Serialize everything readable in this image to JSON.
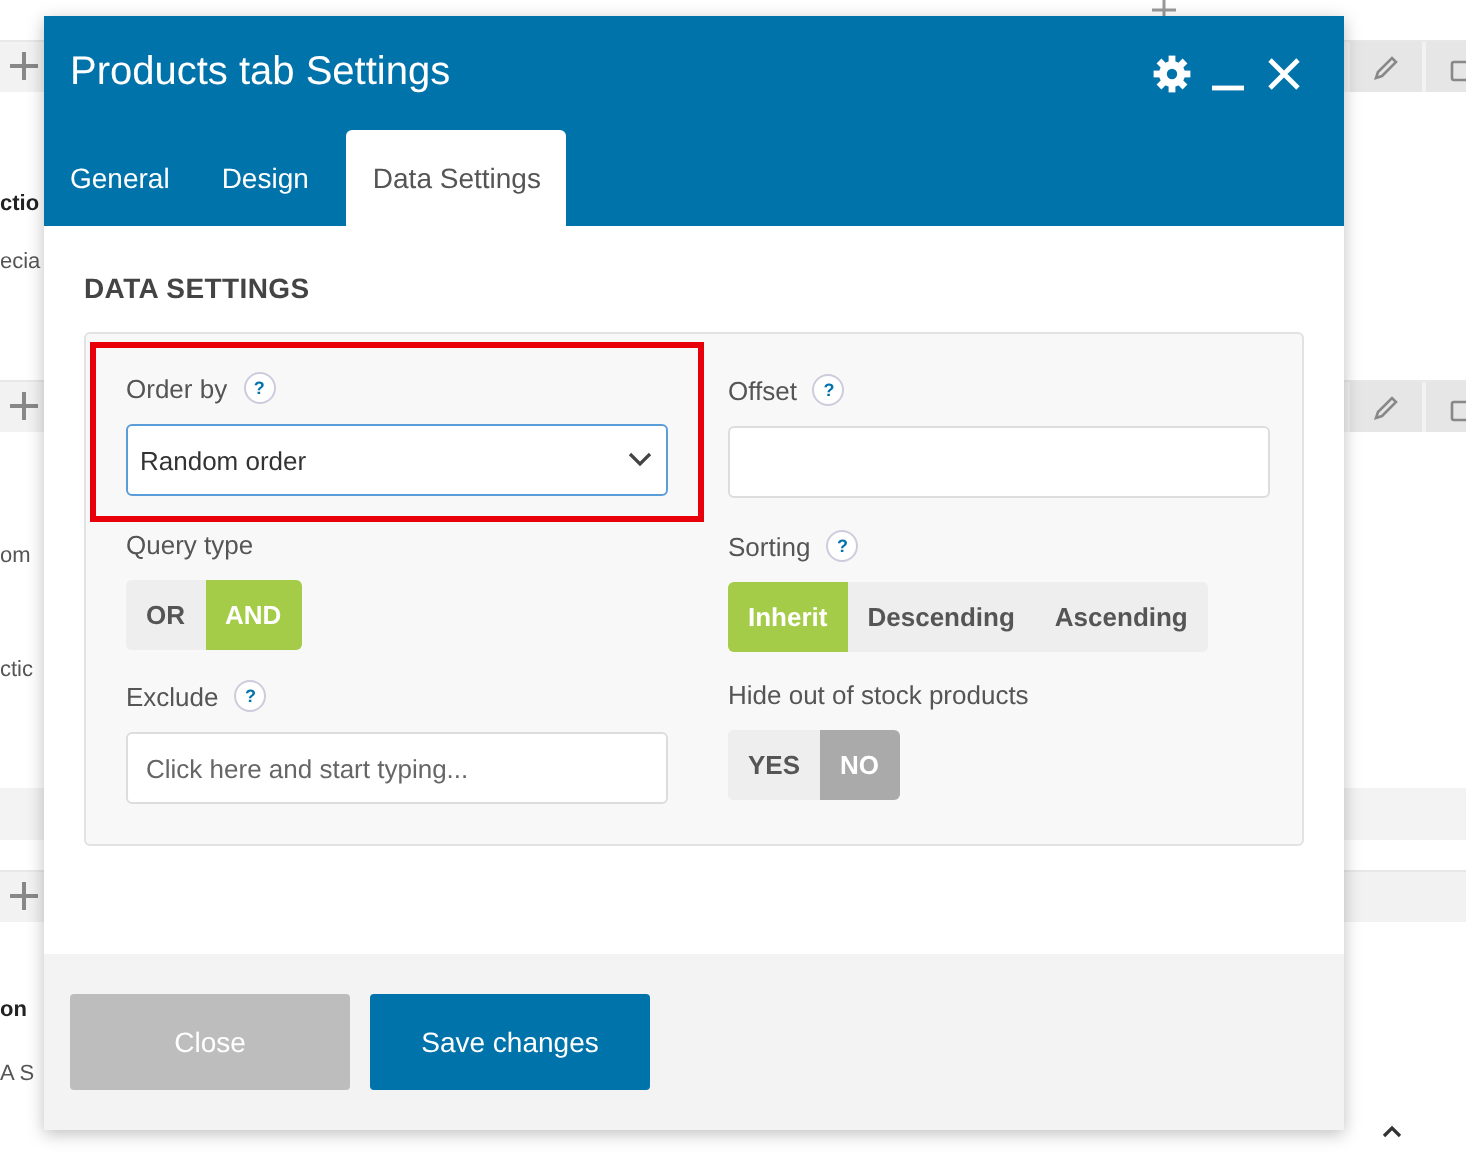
{
  "background": {
    "rows": [
      {
        "kind": "toolbar",
        "actions": true
      },
      {
        "kind": "text",
        "text": "ctio",
        "bold": true
      },
      {
        "kind": "text",
        "text": "ecia",
        "bold": false
      },
      {
        "kind": "toolbar",
        "actions": true
      },
      {
        "kind": "text",
        "text": "om",
        "bold": false
      },
      {
        "kind": "text",
        "text": "ctic",
        "bold": false
      },
      {
        "kind": "band"
      },
      {
        "kind": "toolbar",
        "actions": false
      },
      {
        "kind": "text",
        "text": "on",
        "bold": true
      },
      {
        "kind": "text",
        "text": "A S",
        "bold": false
      }
    ]
  },
  "dialog": {
    "title": "Products tab Settings",
    "tabs": [
      {
        "label": "General",
        "selected": false
      },
      {
        "label": "Design",
        "selected": false
      },
      {
        "label": "Data Settings",
        "selected": true
      }
    ],
    "section_title": "DATA SETTINGS",
    "fields": [
      {
        "kind": "select",
        "label": "Order by",
        "help": "?",
        "highlighted": true,
        "value": "Random order"
      },
      {
        "kind": "text",
        "label": "Offset",
        "help": "?",
        "highlighted": false
      },
      {
        "kind": "segmented",
        "label": "Query type",
        "highlighted": false,
        "options": [
          {
            "label": "OR",
            "selected": false
          },
          {
            "label": "AND",
            "selected": true
          }
        ]
      },
      {
        "kind": "segmented",
        "label": "Sorting",
        "help": "?",
        "highlighted": false,
        "options": [
          {
            "label": "Inherit",
            "selected": true
          },
          {
            "label": "Descending",
            "selected": false
          },
          {
            "label": "Ascending",
            "selected": false
          }
        ]
      },
      {
        "kind": "text",
        "label": "Exclude",
        "help": "?",
        "highlighted": false,
        "placeholder": "Click here and start typing..."
      },
      {
        "kind": "toggle",
        "label": "Hide out of stock products",
        "highlighted": false,
        "options": [
          {
            "label": "YES",
            "selected": false
          },
          {
            "label": "NO",
            "selected": true
          }
        ]
      }
    ],
    "buttons": [
      {
        "label": "Close",
        "primary": false
      },
      {
        "label": "Save changes",
        "primary": true
      }
    ]
  }
}
